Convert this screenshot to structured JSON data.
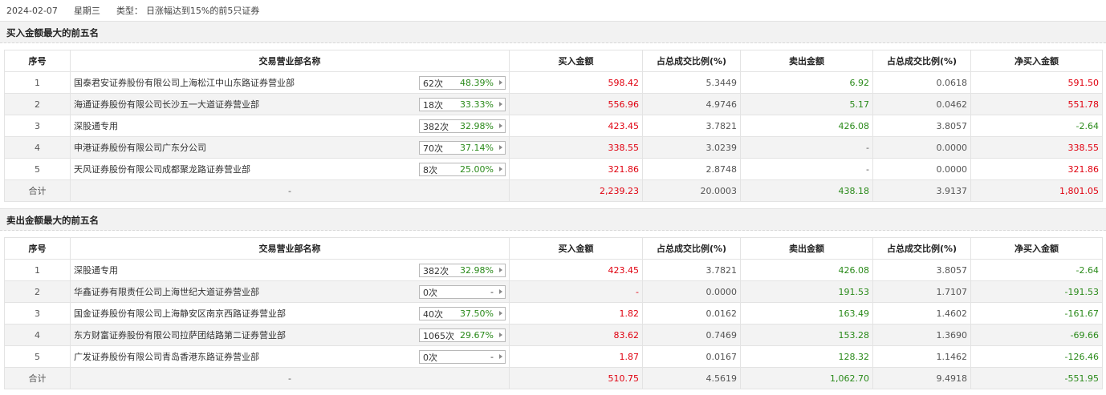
{
  "header": {
    "date": "2024-02-07",
    "weekday": "星期三",
    "type_label": "类型：",
    "type_value": "日涨幅达到15%的前5只证券"
  },
  "columns": [
    "序号",
    "交易营业部名称",
    "买入金额",
    "占总成交比例(%)",
    "卖出金额",
    "占总成交比例(%)",
    "净买入金额"
  ],
  "buy_section": {
    "title": "买入金额最大的前五名",
    "rows": [
      {
        "idx": "1",
        "name": "国泰君安证券股份有限公司上海松江中山东路证券营业部",
        "count": "62次",
        "pct": "48.39%",
        "buy": "598.42",
        "buy_ratio": "5.3449",
        "sell": "6.92",
        "sell_ratio": "0.0618",
        "net": "591.50"
      },
      {
        "idx": "2",
        "name": "海通证券股份有限公司长沙五一大道证券营业部",
        "count": "18次",
        "pct": "33.33%",
        "buy": "556.96",
        "buy_ratio": "4.9746",
        "sell": "5.17",
        "sell_ratio": "0.0462",
        "net": "551.78"
      },
      {
        "idx": "3",
        "name": "深股通专用",
        "count": "382次",
        "pct": "32.98%",
        "buy": "423.45",
        "buy_ratio": "3.7821",
        "sell": "426.08",
        "sell_ratio": "3.8057",
        "net": "-2.64"
      },
      {
        "idx": "4",
        "name": "申港证券股份有限公司广东分公司",
        "count": "70次",
        "pct": "37.14%",
        "buy": "338.55",
        "buy_ratio": "3.0239",
        "sell": "-",
        "sell_ratio": "0.0000",
        "net": "338.55"
      },
      {
        "idx": "5",
        "name": "天风证券股份有限公司成都聚龙路证券营业部",
        "count": "8次",
        "pct": "25.00%",
        "buy": "321.86",
        "buy_ratio": "2.8748",
        "sell": "-",
        "sell_ratio": "0.0000",
        "net": "321.86"
      }
    ],
    "total": {
      "label": "合计",
      "name": "-",
      "buy": "2,239.23",
      "buy_ratio": "20.0003",
      "sell": "438.18",
      "sell_ratio": "3.9137",
      "net": "1,801.05"
    }
  },
  "sell_section": {
    "title": "卖出金额最大的前五名",
    "rows": [
      {
        "idx": "1",
        "name": "深股通专用",
        "count": "382次",
        "pct": "32.98%",
        "buy": "423.45",
        "buy_ratio": "3.7821",
        "sell": "426.08",
        "sell_ratio": "3.8057",
        "net": "-2.64"
      },
      {
        "idx": "2",
        "name": "华鑫证券有限责任公司上海世纪大道证券营业部",
        "count": "0次",
        "pct": "-",
        "buy": "-",
        "buy_ratio": "0.0000",
        "sell": "191.53",
        "sell_ratio": "1.7107",
        "net": "-191.53"
      },
      {
        "idx": "3",
        "name": "国金证券股份有限公司上海静安区南京西路证券营业部",
        "count": "40次",
        "pct": "37.50%",
        "buy": "1.82",
        "buy_ratio": "0.0162",
        "sell": "163.49",
        "sell_ratio": "1.4602",
        "net": "-161.67"
      },
      {
        "idx": "4",
        "name": "东方财富证券股份有限公司拉萨团结路第二证券营业部",
        "count": "1065次",
        "pct": "29.67%",
        "buy": "83.62",
        "buy_ratio": "0.7469",
        "sell": "153.28",
        "sell_ratio": "1.3690",
        "net": "-69.66"
      },
      {
        "idx": "5",
        "name": "广发证券股份有限公司青岛香港东路证券营业部",
        "count": "0次",
        "pct": "-",
        "buy": "1.87",
        "buy_ratio": "0.0167",
        "sell": "128.32",
        "sell_ratio": "1.1462",
        "net": "-126.46"
      }
    ],
    "total": {
      "label": "合计",
      "name": "-",
      "buy": "510.75",
      "buy_ratio": "4.5619",
      "sell": "1,062.70",
      "sell_ratio": "9.4918",
      "net": "-551.95"
    }
  },
  "colors": {
    "buy": "#e0000f",
    "sell": "#2a8a1a"
  }
}
